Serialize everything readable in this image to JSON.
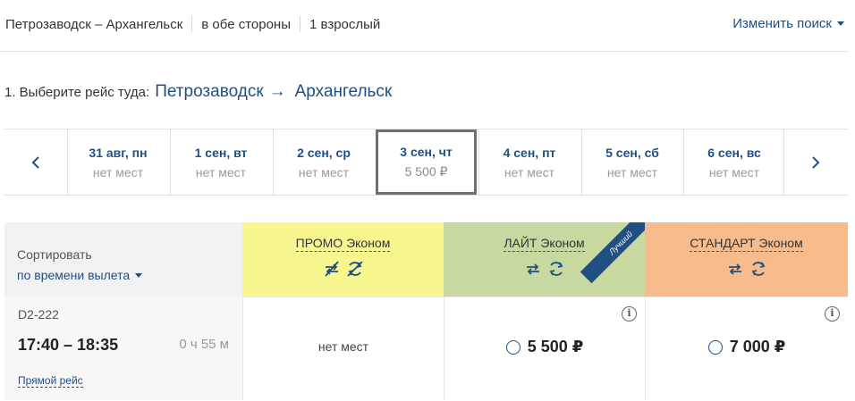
{
  "summary": {
    "route": "Петрозаводск – Архангельск",
    "trip_type": "в обе стороны",
    "passengers": "1 взрослый",
    "change_search": "Изменить поиск"
  },
  "step": {
    "prefix": "1. Выберите рейс туда:",
    "from": "Петрозаводск",
    "arrow": "→",
    "to": "Архангельск"
  },
  "dates": [
    {
      "date": "31 авг, пн",
      "status": "нет мест"
    },
    {
      "date": "1 сен, вт",
      "status": "нет мест"
    },
    {
      "date": "2 сен, ср",
      "status": "нет мест"
    },
    {
      "date": "3 сен, чт",
      "status": "5 500 ₽",
      "selected": true
    },
    {
      "date": "4 сен, пт",
      "status": "нет мест"
    },
    {
      "date": "5 сен, сб",
      "status": "нет мест"
    },
    {
      "date": "6 сен, вс",
      "status": "нет мест"
    }
  ],
  "sort": {
    "label": "Сортировать",
    "value": "по времени вылета"
  },
  "fares": [
    {
      "name": "ПРОМО Эконом",
      "color": "#f8f78f",
      "icons": [
        "no-exchange-icon",
        "no-refund-icon"
      ]
    },
    {
      "name": "ЛАЙТ Эконом",
      "color": "#c7d9a0",
      "badge": "Лучший",
      "icons": [
        "exchange-icon",
        "refund-icon"
      ]
    },
    {
      "name": "СТАНДАРТ Эконом",
      "color": "#f8bb8b",
      "icons": [
        "exchange-icon",
        "refund-icon"
      ]
    }
  ],
  "flight": {
    "number": "D2-222",
    "time": "17:40 – 18:35",
    "duration": "0 ч 55 м",
    "direct": "Прямой рейс",
    "promo": "нет мест",
    "lite_price": "5 500 ₽",
    "std_price": "7 000 ₽",
    "info": "i"
  },
  "colors": {
    "accent": "#1f4f85"
  }
}
